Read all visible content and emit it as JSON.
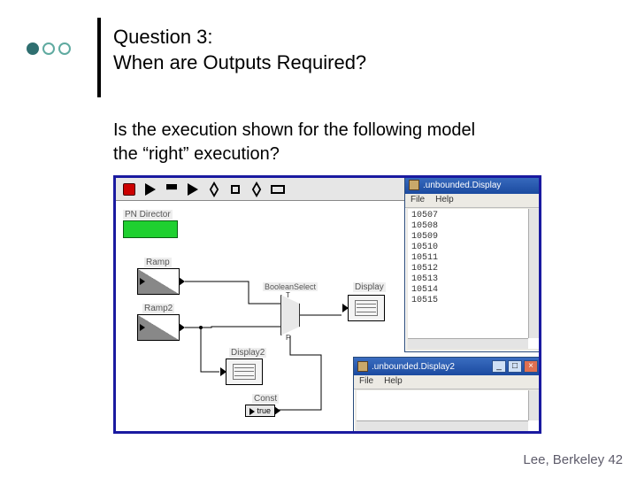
{
  "title": {
    "line1": "Question 3:",
    "line2": "When are Outputs Required?"
  },
  "body": {
    "line1": "Is the execution shown for the following model",
    "line2": "the “right” execution?"
  },
  "footer": {
    "text": "Lee, Berkeley ",
    "page": "42"
  },
  "model": {
    "director_label": "PN Director",
    "actors": {
      "ramp": "Ramp",
      "ramp2": "Ramp2",
      "boolean_select": "BooleanSelect",
      "mux_t": "T",
      "mux_f": "F",
      "display": "Display",
      "display2": "Display2",
      "const": "Const",
      "const_value": "true"
    }
  },
  "windows": {
    "display": {
      "title": ".unbounded.Display",
      "menu": [
        "File",
        "Help"
      ],
      "values": [
        "10507",
        "10508",
        "10509",
        "10510",
        "10511",
        "10512",
        "10513",
        "10514",
        "10515",
        ""
      ]
    },
    "display2": {
      "title": ".unbounded.Display2",
      "menu": [
        "File",
        "Help"
      ]
    }
  }
}
